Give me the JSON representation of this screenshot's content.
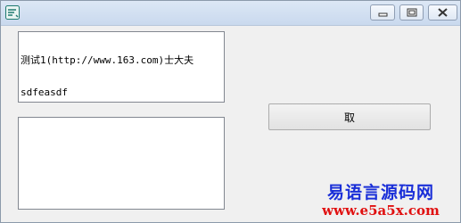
{
  "titlebar": {
    "app_icon": "app-logo-icon",
    "minimize_icon": "minimize-icon",
    "maximize_icon": "maximize-icon",
    "close_icon": "close-icon"
  },
  "textbox_top": {
    "lines": [
      "测试1(http://www.163.com)士大夫",
      "sdfeasdf"
    ]
  },
  "textbox_bottom": {
    "value": ""
  },
  "action_button": {
    "label": "取"
  },
  "watermark": {
    "line1": "易语言源码网",
    "line2": "www.e5a5x.com"
  },
  "colors": {
    "watermark_blue": "#1a2fd8",
    "watermark_red": "#e01010",
    "titlebar": "#d5e2f2"
  }
}
